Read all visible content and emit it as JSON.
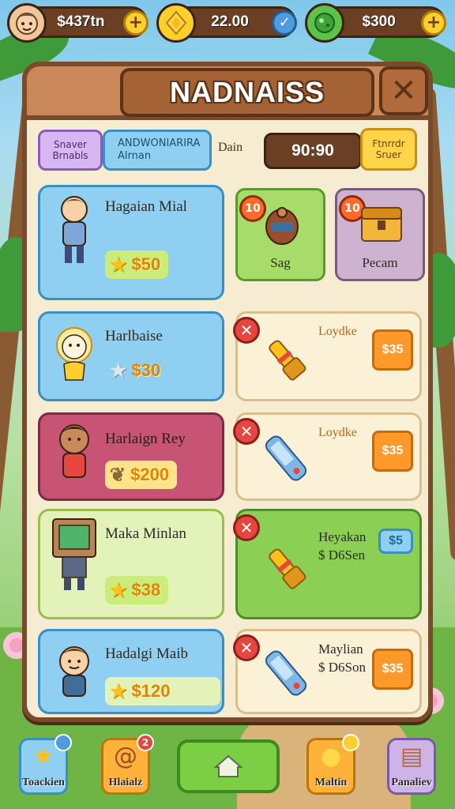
{
  "top_bar": {
    "resources": [
      {
        "icon": "avatar-icon",
        "value": "$437tn",
        "action": "+"
      },
      {
        "icon": "gold-coin-icon",
        "value": "22.00",
        "action": "✓"
      },
      {
        "icon": "green-gem-icon",
        "value": "$300",
        "action": "+"
      }
    ]
  },
  "panel": {
    "title": "NADNAISS",
    "close_label": "✕"
  },
  "tabs": {
    "tab_a": {
      "line1": "Snaver",
      "line2": "Brnabls"
    },
    "tab_b": {
      "line1": "ANDWONIARIRA",
      "line2": "Alrnan"
    },
    "balance_label": "Dain",
    "balance_value": "90:90",
    "tab_c": {
      "line1": "Ftnrrdr",
      "line2": "Sruer"
    }
  },
  "characters": [
    {
      "name": "Hagaian Mial",
      "price": "$50",
      "icon": "star-icon"
    },
    {
      "name": "Harlbaise",
      "price": "$30",
      "icon": "silver-star-icon"
    },
    {
      "name": "Harlaign Rey",
      "price": "$200",
      "icon": "leaf-icon"
    },
    {
      "name": "Maka Minlan",
      "price": "$38",
      "icon": "star-icon"
    },
    {
      "name": "Hadalgi Maib",
      "price": "$120",
      "icon": "star-icon"
    }
  ],
  "featured_items": [
    {
      "badge": "10",
      "label": "Sag"
    },
    {
      "badge": "10",
      "label": "Pecam"
    }
  ],
  "items": [
    {
      "label": "Loydke",
      "price": "$35"
    },
    {
      "label": "Loydke",
      "price": "$35"
    },
    {
      "label": "Heyakan\n$ D6Sen",
      "price": "$5"
    },
    {
      "label": "Maylian\n$ D6Son",
      "price": "$35"
    }
  ],
  "bottom_nav": [
    {
      "label": "Toackien",
      "icon": "star-icon",
      "badge": ""
    },
    {
      "label": "Hlaialz",
      "icon": "spiral-icon",
      "badge": "2"
    },
    {
      "label": "",
      "icon": "home-icon",
      "badge": ""
    },
    {
      "label": "Maltin",
      "icon": "orb-icon",
      "badge": ""
    },
    {
      "label": "Panaliev",
      "icon": "chest-icon",
      "badge": ""
    }
  ],
  "colors": {
    "panel_bg": "#f6ecd1",
    "wood": "#7a4b2a",
    "card_blue": "#8fd0f2",
    "card_red": "#c75474",
    "card_green": "#8ccf55",
    "card_lime": "#e3f2b9",
    "price_orange": "#ff9a2a"
  }
}
